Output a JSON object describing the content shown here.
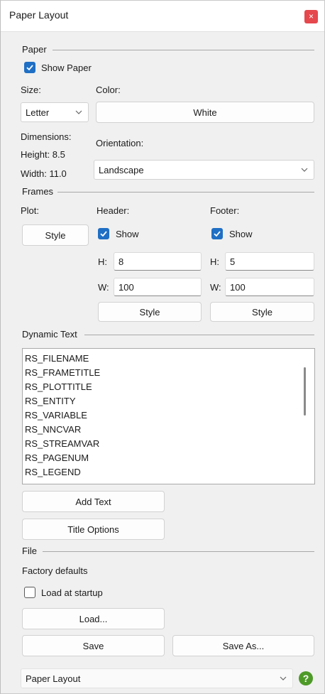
{
  "window": {
    "title": "Paper Layout",
    "close_glyph": "×"
  },
  "paper": {
    "section": "Paper",
    "show_paper": {
      "label": "Show Paper",
      "checked": true
    },
    "size_label": "Size:",
    "size_value": "Letter",
    "color_label": "Color:",
    "color_value": "White",
    "dimensions_label": "Dimensions:",
    "height_text": "Height: 8.5",
    "width_text": "Width:  11.0",
    "orientation_label": "Orientation:",
    "orientation_value": "Landscape"
  },
  "frames": {
    "section": "Frames",
    "plot_label": "Plot:",
    "plot_style": "Style",
    "header": {
      "label": "Header:",
      "show": "Show",
      "checked": true,
      "h_label": "H:",
      "h_value": "8",
      "w_label": "W:",
      "w_value": "100",
      "style": "Style"
    },
    "footer": {
      "label": "Footer:",
      "show": "Show",
      "checked": true,
      "h_label": "H:",
      "h_value": "5",
      "w_label": "W:",
      "w_value": "100",
      "style": "Style"
    }
  },
  "dynamic_text": {
    "section": "Dynamic Text",
    "items": [
      "RS_FILENAME",
      "RS_FRAMETITLE",
      "RS_PLOTTITLE",
      "RS_ENTITY",
      "RS_VARIABLE",
      "RS_NNCVAR",
      "RS_STREAMVAR",
      "RS_PAGENUM",
      "RS_LEGEND"
    ],
    "add_text": "Add Text",
    "title_options": "Title Options"
  },
  "file": {
    "section": "File",
    "factory_defaults": "Factory defaults",
    "load_at_startup": {
      "label": "Load at startup",
      "checked": false
    },
    "load": "Load...",
    "save": "Save",
    "save_as": "Save As..."
  },
  "footer_bar": {
    "preset_value": "Paper Layout",
    "help_glyph": "?"
  },
  "icons": {
    "check": "check-icon",
    "chevron": "chevron-down-icon",
    "help": "help-icon",
    "close": "close-icon"
  },
  "colors": {
    "accent": "#1f6fc4",
    "close_red": "#e5484d",
    "help_green": "#4e9a28"
  }
}
